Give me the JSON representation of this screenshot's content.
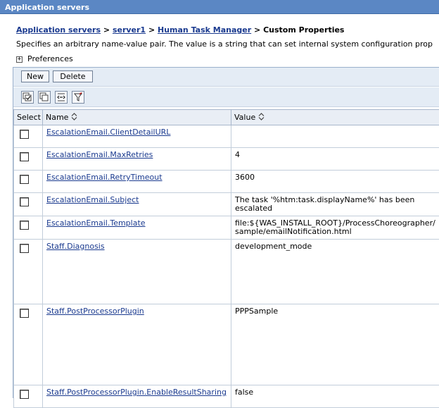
{
  "window": {
    "title": "Application servers"
  },
  "breadcrumb": {
    "link1": "Application servers",
    "sep1": ">",
    "link2": "server1",
    "sep2": ">",
    "link3": "Human Task Manager",
    "sep3": ">",
    "current": "Custom Properties"
  },
  "description": "Specifies an arbitrary name-value pair. The value is a string that can set internal system configuration prop",
  "preferences": {
    "toggle": "+",
    "label": "Preferences"
  },
  "toolbar": {
    "new_label": "New",
    "delete_label": "Delete"
  },
  "icons": [
    "select-all-icon",
    "deselect-all-icon",
    "show-filter-icon",
    "clear-filter-icon"
  ],
  "table": {
    "columns": {
      "select": "Select",
      "name": "Name",
      "value": "Value"
    },
    "rows": [
      {
        "name": "EscalationEmail.ClientDetailURL",
        "value": ""
      },
      {
        "name": "EscalationEmail.MaxRetries",
        "value": "4"
      },
      {
        "name": "EscalationEmail.RetryTimeout",
        "value": "3600"
      },
      {
        "name": "EscalationEmail.Subject",
        "value": "The task '%htm:task.displayName%' has been escalated"
      },
      {
        "name": "EscalationEmail.Template",
        "value": "file:${WAS_INSTALL_ROOT}/ProcessChoreographer/sample/emailNotification.html"
      },
      {
        "name": "Staff.Diagnosis",
        "value": "development_mode"
      },
      {
        "name": "Staff.PostProcessorPlugin",
        "value": "PPPSample"
      },
      {
        "name": "Staff.PostProcessorPlugin.EnableResultSharing",
        "value": "false"
      }
    ]
  },
  "colors": {
    "titlebar": "#5b87c4",
    "link": "#1a3a8f",
    "toolbar_bg": "#e4ecf5",
    "header_bg": "#e9eef5"
  }
}
